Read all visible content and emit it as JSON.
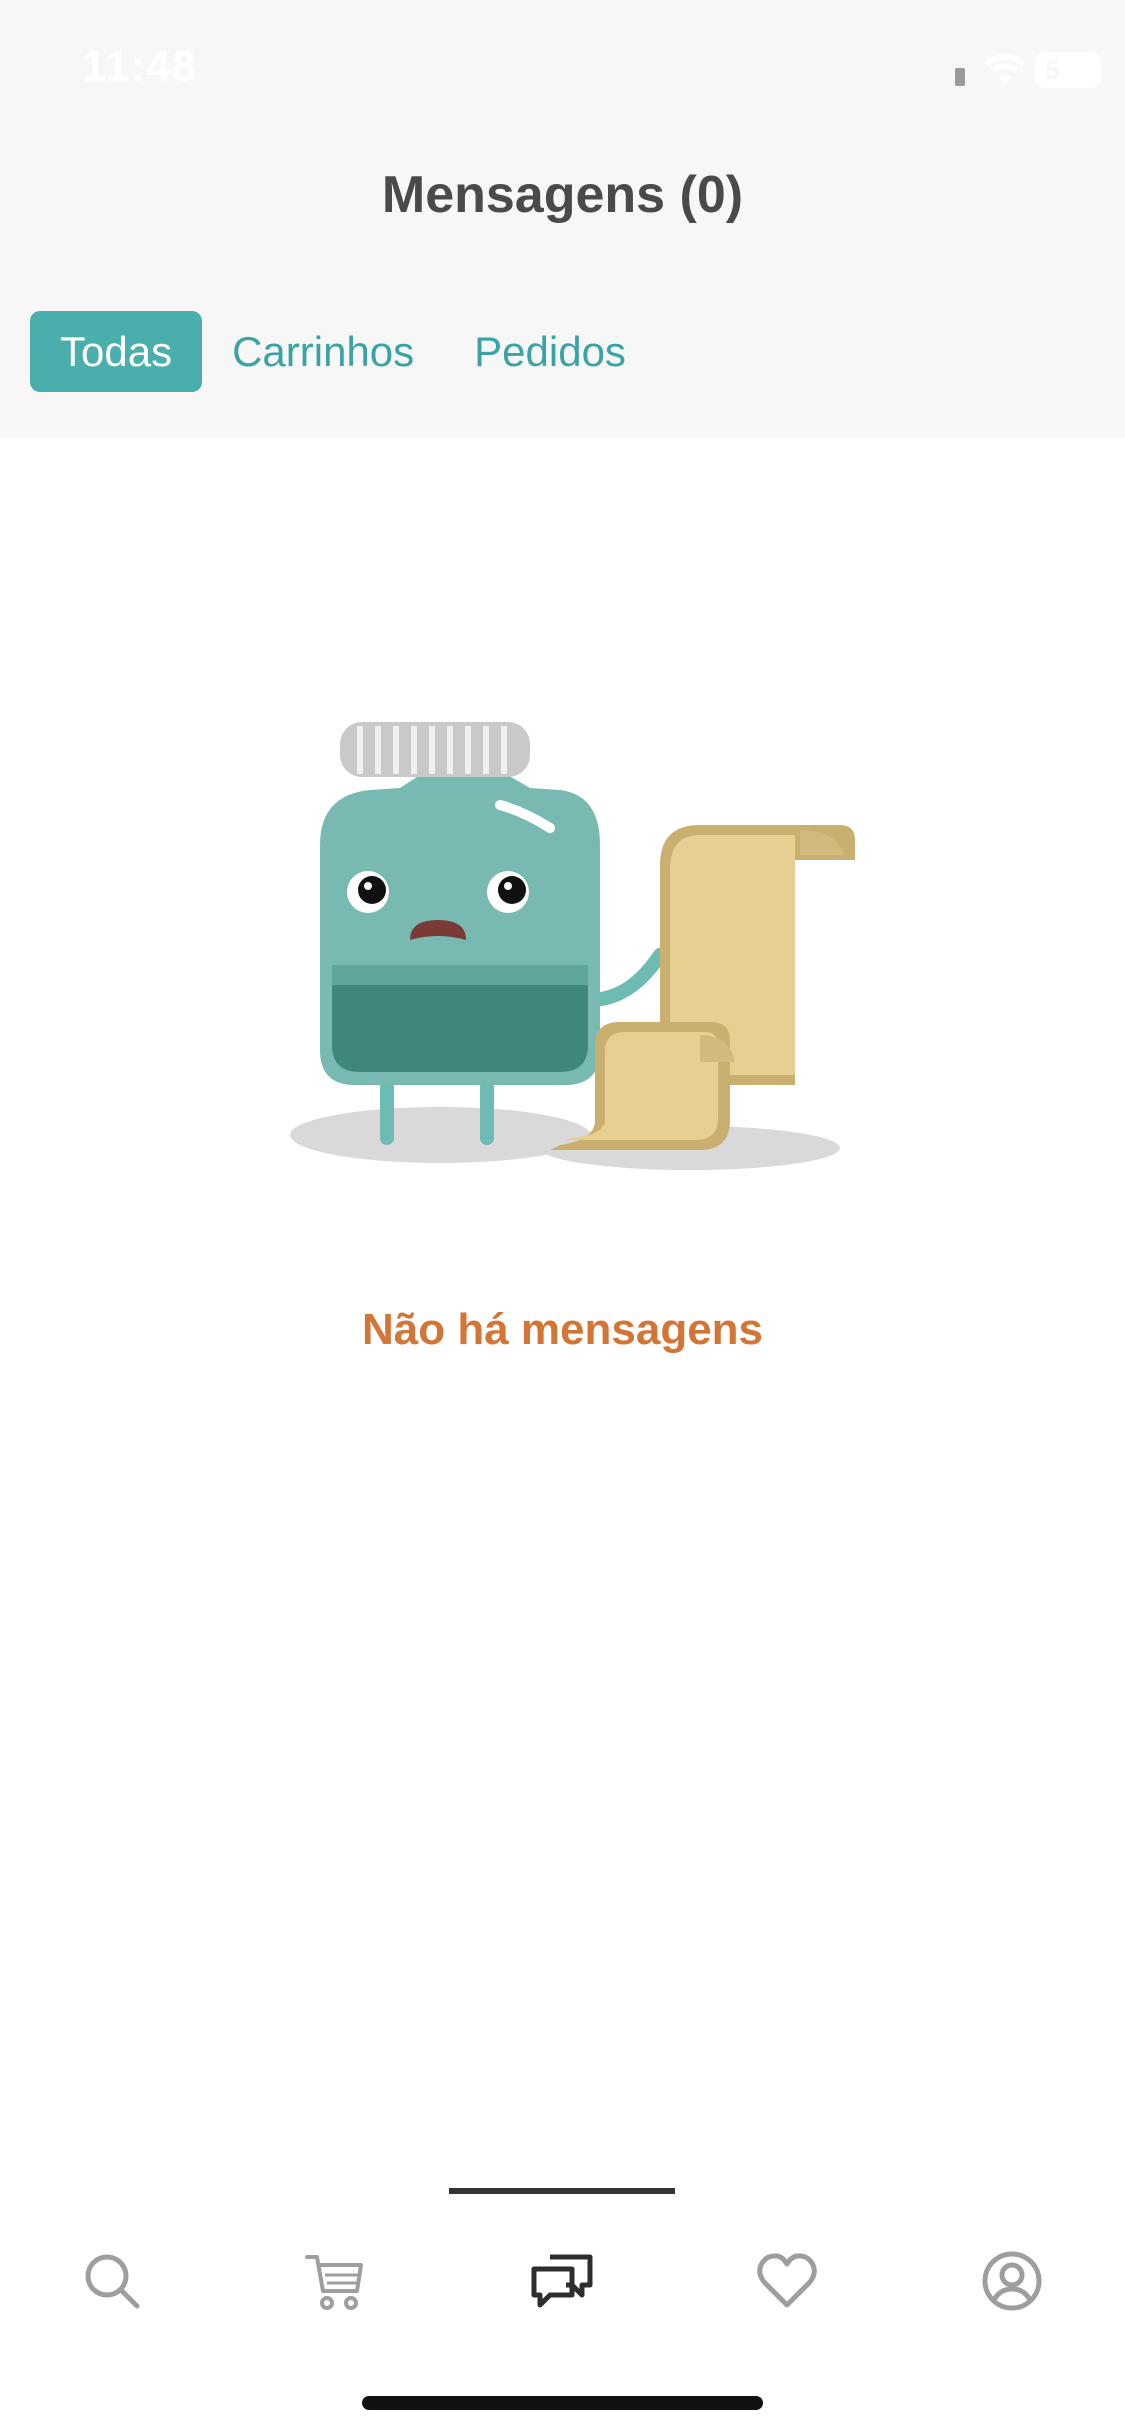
{
  "status_bar": {
    "time": "11:48",
    "battery": "5"
  },
  "header": {
    "title": "Mensagens (0)"
  },
  "tabs": [
    {
      "label": "Todas",
      "active": true
    },
    {
      "label": "Carrinhos",
      "active": false
    },
    {
      "label": "Pedidos",
      "active": false
    }
  ],
  "empty_state": {
    "message": "Não há mensagens",
    "illustration": "sad-jar-with-scroll"
  },
  "bottom_nav": {
    "items": [
      {
        "icon": "search-icon",
        "active": false
      },
      {
        "icon": "cart-icon",
        "active": false
      },
      {
        "icon": "messages-icon",
        "active": true
      },
      {
        "icon": "heart-icon",
        "active": false
      },
      {
        "icon": "profile-icon",
        "active": false
      }
    ]
  },
  "colors": {
    "accent": "#4aaeac",
    "empty_text": "#d27537",
    "tab_text": "#3aa3a3"
  }
}
